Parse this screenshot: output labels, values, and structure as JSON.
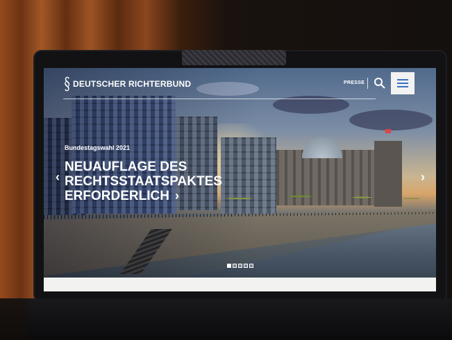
{
  "header": {
    "logo_text": "DEUTSCHER RICHTERBUND",
    "press_label": "PRESSE",
    "icons": {
      "search": "search-icon",
      "menu": "hamburger-menu-icon",
      "logo": "section-logo-icon"
    }
  },
  "slider": {
    "eyebrow": "Bundestagswahl 2021",
    "headline_lines": [
      "NEUAUFLAGE DES",
      "RECHTSSTAATSPAKTES",
      "ERFORDERLICH"
    ],
    "prev_glyph": "‹",
    "next_glyph": "›",
    "headline_arrow": "›",
    "slides_total": 5,
    "active_slide": 1
  },
  "colors": {
    "menu_button_bg": "#f2f2f2",
    "menu_bars": "#3a6fbf",
    "text": "#ffffff"
  }
}
